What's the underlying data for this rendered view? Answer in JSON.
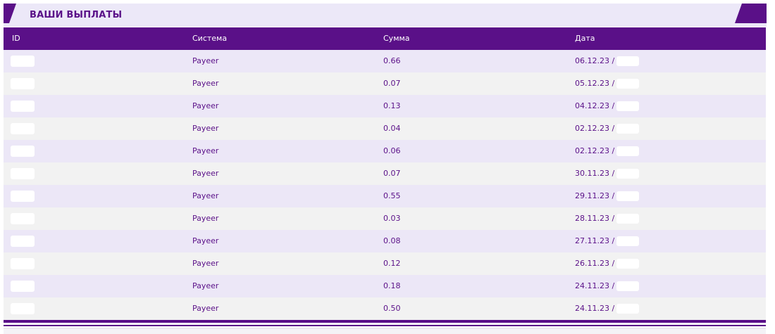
{
  "section": {
    "title": "ВАШИ ВЫПЛАТЫ"
  },
  "colors": {
    "accent": "#5a1088",
    "row_odd": "#ece7f7",
    "row_even": "#f2f2f2",
    "title_bg": "#ece8f8"
  },
  "table": {
    "headers": {
      "id": "ID",
      "system": "Система",
      "sum": "Сумма",
      "date": "Дата"
    },
    "rows": [
      {
        "id": "",
        "system": "Payeer",
        "sum": "0.66",
        "date": "06.12.23 /"
      },
      {
        "id": "",
        "system": "Payeer",
        "sum": "0.07",
        "date": "05.12.23 /"
      },
      {
        "id": "",
        "system": "Payeer",
        "sum": "0.13",
        "date": "04.12.23 /"
      },
      {
        "id": "",
        "system": "Payeer",
        "sum": "0.04",
        "date": "02.12.23 /"
      },
      {
        "id": "",
        "system": "Payeer",
        "sum": "0.06",
        "date": "02.12.23 /"
      },
      {
        "id": "",
        "system": "Payeer",
        "sum": "0.07",
        "date": "30.11.23 /"
      },
      {
        "id": "",
        "system": "Payeer",
        "sum": "0.55",
        "date": "29.11.23 /"
      },
      {
        "id": "",
        "system": "Payeer",
        "sum": "0.03",
        "date": "28.11.23 /"
      },
      {
        "id": "",
        "system": "Payeer",
        "sum": "0.08",
        "date": "27.11.23 /"
      },
      {
        "id": "",
        "system": "Payeer",
        "sum": "0.12",
        "date": "26.11.23 /"
      },
      {
        "id": "",
        "system": "Payeer",
        "sum": "0.18",
        "date": "24.11.23 /"
      },
      {
        "id": "",
        "system": "Payeer",
        "sum": "0.50",
        "date": "24.11.23 /"
      }
    ]
  }
}
